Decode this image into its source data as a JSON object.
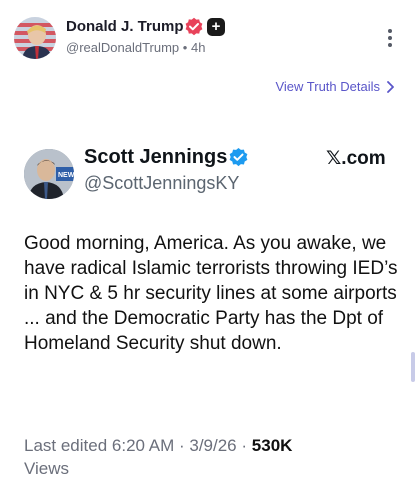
{
  "post": {
    "author_name": "Donald J. Trump",
    "handle": "@realDonaldTrump",
    "separator": "•",
    "time_ago": "4h",
    "view_details_label": "View Truth Details"
  },
  "embed": {
    "author_name": "Scott Jennings",
    "handle": "@ScottJenningsKY",
    "source": "𝕏.com",
    "text": "Good morning, America. As you awake, we have radical Islamic terrorists throwing IED’s in NYC & 5 hr security lines at some airports ... and the Democratic Party has the Dpt of Homeland Security shut down.",
    "last_edited_label": "Last edited 6:20 AM · 3/9/26",
    "dot": "·",
    "views_count": "530K",
    "views_label": "Views"
  },
  "colors": {
    "accent": "#5a56c9",
    "verified_red": "#e8425a",
    "verified_blue": "#1d9bf0"
  },
  "icons": {
    "main_verified": "verified-badge-icon",
    "plus_badge": "plus-badge-icon",
    "more": "more-vertical-icon",
    "chevron": "chevron-right-icon",
    "card_verified": "blue-verified-icon"
  }
}
